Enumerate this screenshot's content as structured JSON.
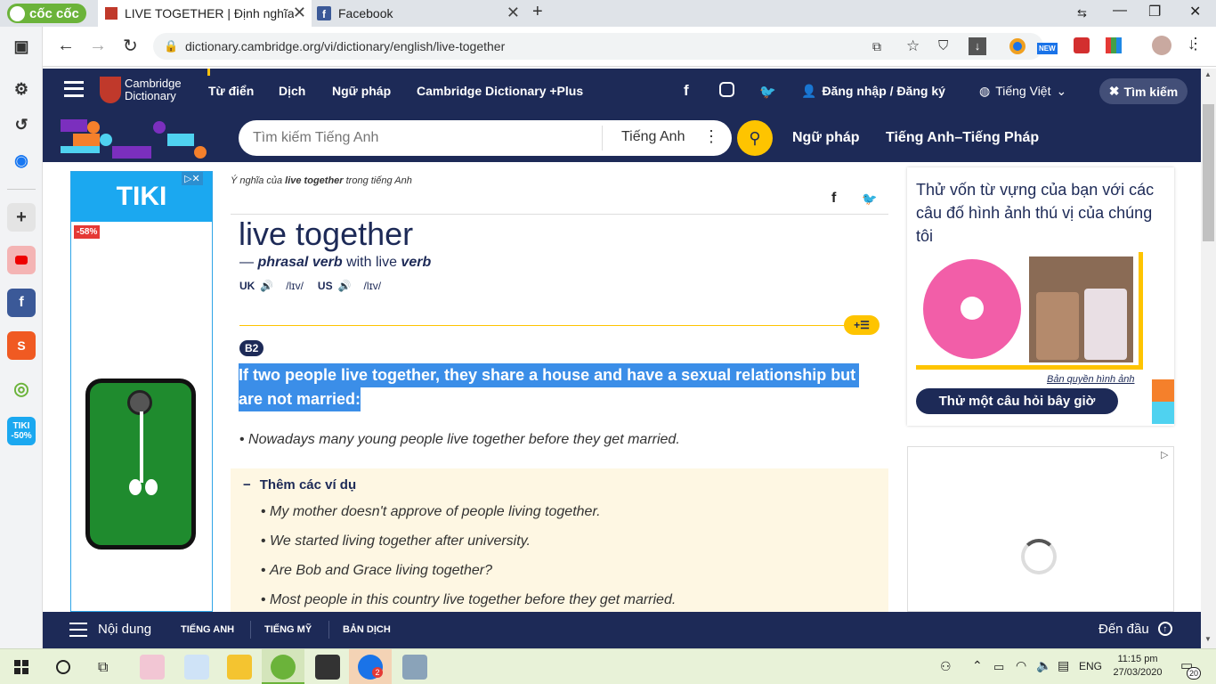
{
  "browser": {
    "brand": "cốc cốc",
    "tabs": [
      {
        "title": "LIVE TOGETHER | Định nghĩa"
      },
      {
        "title": "Facebook"
      }
    ],
    "url": "dictionary.cambridge.org/vi/dictionary/english/live-together",
    "new_badge": "NEW"
  },
  "header": {
    "logo_line1": "Cambridge",
    "logo_line2": "Dictionary",
    "nav": [
      "Từ điển",
      "Dịch",
      "Ngữ pháp",
      "Cambridge Dictionary +Plus"
    ],
    "login": "Đăng nhập / Đăng ký",
    "language": "Tiếng Việt",
    "search_button": "Tìm kiếm"
  },
  "search": {
    "placeholder": "Tìm kiếm Tiếng Anh",
    "dict": "Tiếng Anh",
    "links": [
      "Ngữ pháp",
      "Tiếng Anh–Tiếng Pháp"
    ]
  },
  "entry": {
    "breadcrumb_pre": "Ý nghĩa của ",
    "breadcrumb_word": "live together",
    "breadcrumb_post": " trong tiếng Anh",
    "headword": "live together",
    "pos_dash": "—",
    "pos": "phrasal verb",
    "with": "with live",
    "verb": "verb",
    "uk": "UK",
    "uk_ipa": "/lɪv/",
    "us": "US",
    "us_ipa": "/lɪv/",
    "level": "B2",
    "definition_l1": "If two people live together, they share a house and have a sexual relationship but",
    "definition_l2": "are not married:",
    "example": "Nowadays many young people live together before they get married.",
    "more_examples_label": "Thêm các ví dụ",
    "more_examples": [
      "My mother doesn't approve of people living together.",
      "We started living together after university.",
      "Are Bob and Grace living together?",
      "Most people in this country live together before they get married."
    ]
  },
  "ad_left": {
    "brand": "TIKI",
    "discount": "-58%"
  },
  "quiz": {
    "title": "Thử vốn từ vựng của bạn với các câu đố hình ảnh thú vị của chúng tôi",
    "copyright": "Bản quyền hình ảnh",
    "button": "Thử một câu hỏi bây giờ"
  },
  "bottombar": {
    "menu": "Nội dung",
    "tabs": [
      "TIẾNG ANH",
      "TIẾNG MỸ",
      "BẢN DỊCH"
    ],
    "top": "Đến đầu"
  },
  "taskbar": {
    "lang": "ENG",
    "time": "11:15 pm",
    "date": "27/03/2020",
    "notif_count": "20",
    "zalo_badge": "2"
  },
  "sidebar": {
    "tiki_badge_l1": "TIKI",
    "tiki_badge_l2": "-50%"
  }
}
